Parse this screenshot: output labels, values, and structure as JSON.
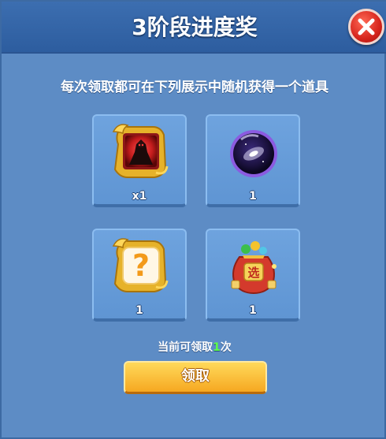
{
  "dialog": {
    "title": "3阶段进度奖",
    "description": "每次领取都可在下列展示中随机获得一个道具"
  },
  "rewards": [
    {
      "icon": "dark-hero-icon",
      "count": "x1"
    },
    {
      "icon": "galaxy-orb-icon",
      "count": "1"
    },
    {
      "icon": "mystery-question-icon",
      "count": "1"
    },
    {
      "icon": "lucky-bag-icon",
      "count": "1",
      "bag_label": "选"
    }
  ],
  "status": {
    "prefix": "当前可领取",
    "count": "1",
    "suffix": "次"
  },
  "claim_button": {
    "label": "领取"
  },
  "colors": {
    "panel": "#5d8cc5",
    "header": "#2d5d9f",
    "slot": "#6ea3de",
    "accent_green": "#5eff47",
    "button": "#f6a821",
    "close": "#d6241c"
  }
}
